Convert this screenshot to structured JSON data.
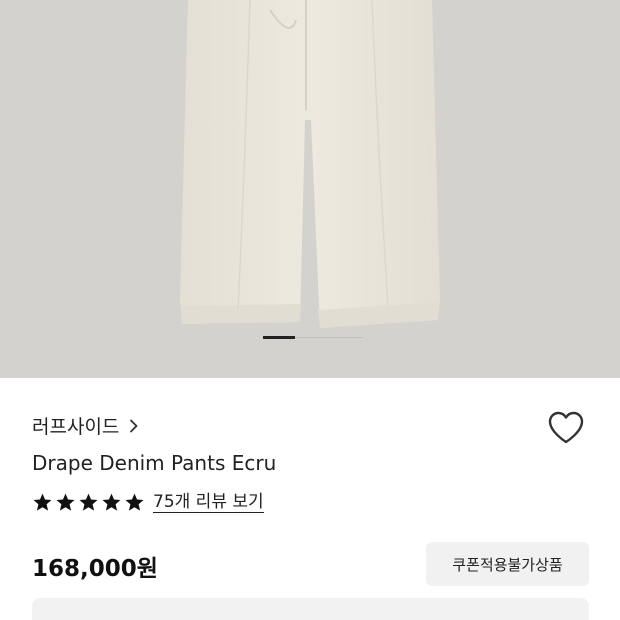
{
  "product": {
    "image_alt": "Drape Denim Pants Ecru",
    "gallery_index": 1,
    "brand": "러프사이드",
    "name": "Drape Denim Pants Ecru",
    "rating_stars": 5,
    "review_link": "75개 리뷰 보기",
    "price": "168,000원",
    "coupon_badge": "쿠폰적용불가상품"
  },
  "icons": {
    "brand_chevron": "chevron-right-icon",
    "wishlist": "heart-outline-icon",
    "star": "star-filled-icon"
  },
  "colors": {
    "hero_background": "#d4d2cf",
    "pants": "#ebe6dc",
    "text": "#222222",
    "coupon_background": "#f1f1f1"
  }
}
